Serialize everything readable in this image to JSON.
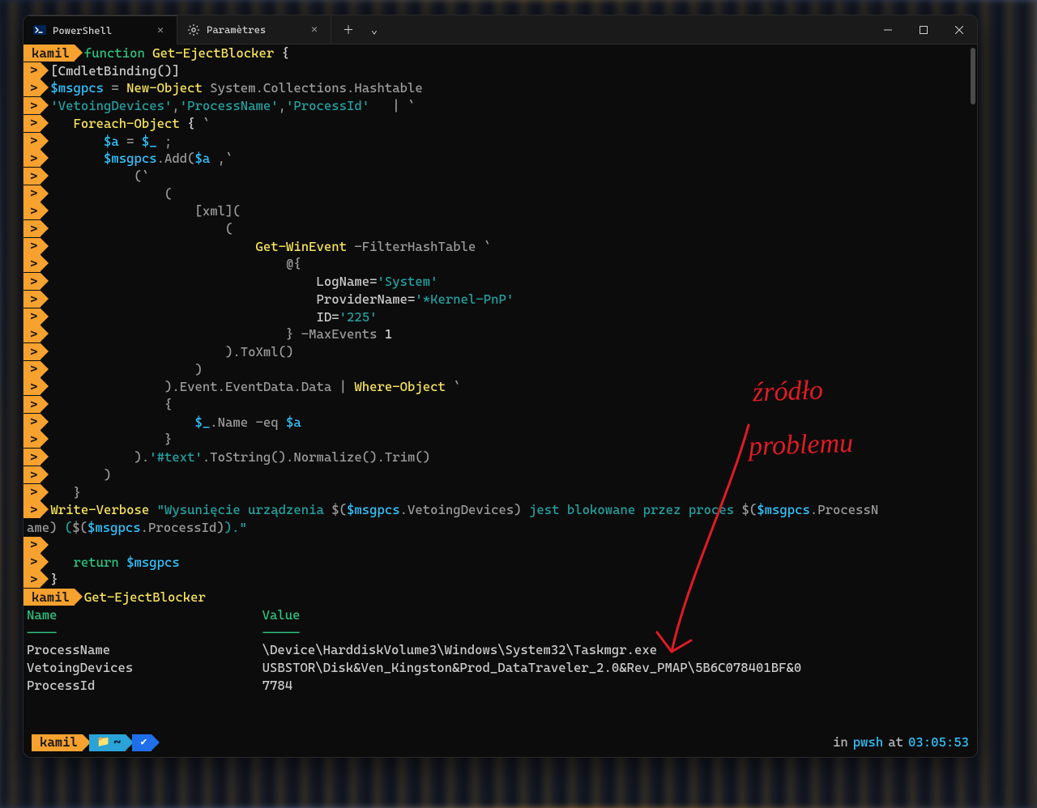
{
  "tabs": [
    {
      "label": "PowerShell",
      "active": true
    },
    {
      "label": "Paramètres",
      "active": false
    }
  ],
  "prompt_user": "kamil",
  "code_lines": [
    [
      [
        "kw",
        "function"
      ],
      [
        "sp",
        " "
      ],
      [
        "fn",
        "Get-EjectBlocker"
      ],
      [
        "sp",
        " "
      ],
      [
        "arrw",
        "{"
      ]
    ],
    [
      [
        "arrw",
        "[CmdletBinding()]"
      ]
    ],
    [
      [
        "var",
        "$msgpcs"
      ],
      [
        "sp",
        " "
      ],
      [
        "op",
        "="
      ],
      [
        "sp",
        " "
      ],
      [
        "cmd",
        "New-Object"
      ],
      [
        "sp",
        " "
      ],
      [
        "dim",
        "System.Collections.Hashtable"
      ]
    ],
    [
      [
        "str",
        "'VetoingDevices'"
      ],
      [
        "op",
        ","
      ],
      [
        "str",
        "'ProcessName'"
      ],
      [
        "op",
        ","
      ],
      [
        "str",
        "'ProcessId'"
      ],
      [
        "sp",
        "   "
      ],
      [
        "op",
        "|"
      ],
      [
        "sp",
        " "
      ],
      [
        "op",
        "`"
      ]
    ],
    [
      [
        "sp",
        "   "
      ],
      [
        "cmd",
        "Foreach-Object"
      ],
      [
        "sp",
        " "
      ],
      [
        "arrw",
        "{"
      ],
      [
        "sp",
        " "
      ],
      [
        "op",
        "`"
      ]
    ],
    [
      [
        "sp",
        "       "
      ],
      [
        "var",
        "$a"
      ],
      [
        "sp",
        " "
      ],
      [
        "op",
        "="
      ],
      [
        "sp",
        " "
      ],
      [
        "var",
        "$_"
      ],
      [
        "sp",
        " "
      ],
      [
        "op",
        ";"
      ]
    ],
    [
      [
        "sp",
        "       "
      ],
      [
        "var",
        "$msgpcs"
      ],
      [
        "op",
        ".Add("
      ],
      [
        "var",
        "$a"
      ],
      [
        "sp",
        " "
      ],
      [
        "op",
        ",`"
      ]
    ],
    [
      [
        "sp",
        "           "
      ],
      [
        "op",
        "(`"
      ]
    ],
    [
      [
        "sp",
        "               "
      ],
      [
        "op",
        "("
      ]
    ],
    [
      [
        "sp",
        "                   "
      ],
      [
        "op",
        "[xml]("
      ]
    ],
    [
      [
        "sp",
        "                       "
      ],
      [
        "op",
        "("
      ]
    ],
    [
      [
        "sp",
        "                           "
      ],
      [
        "cmd",
        "Get-WinEvent"
      ],
      [
        "sp",
        " "
      ],
      [
        "dim",
        "-FilterHashTable"
      ],
      [
        "sp",
        " "
      ],
      [
        "op",
        "`"
      ]
    ],
    [
      [
        "sp",
        "                               "
      ],
      [
        "op",
        "@{"
      ]
    ],
    [
      [
        "sp",
        "                                   "
      ],
      [
        "arrw",
        "LogName="
      ],
      [
        "str",
        "'System'"
      ]
    ],
    [
      [
        "sp",
        "                                   "
      ],
      [
        "arrw",
        "ProviderName="
      ],
      [
        "str",
        "'*Kernel-PnP'"
      ]
    ],
    [
      [
        "sp",
        "                                   "
      ],
      [
        "arrw",
        "ID="
      ],
      [
        "str",
        "'225'"
      ]
    ],
    [
      [
        "sp",
        "                               "
      ],
      [
        "op",
        "}"
      ],
      [
        "sp",
        " "
      ],
      [
        "dim",
        "-MaxEvents"
      ],
      [
        "sp",
        " "
      ],
      [
        "num",
        "1"
      ]
    ],
    [
      [
        "sp",
        "                       "
      ],
      [
        "op",
        ").ToXml()"
      ]
    ],
    [
      [
        "sp",
        "                   "
      ],
      [
        "op",
        ")"
      ]
    ],
    [
      [
        "sp",
        "               "
      ],
      [
        "op",
        ").Event.EventData.Data"
      ],
      [
        "sp",
        " "
      ],
      [
        "op",
        "|"
      ],
      [
        "sp",
        " "
      ],
      [
        "cmd",
        "Where-Object"
      ],
      [
        "sp",
        " "
      ],
      [
        "op",
        "`"
      ]
    ],
    [
      [
        "sp",
        "               "
      ],
      [
        "op",
        "{"
      ]
    ],
    [
      [
        "sp",
        "                   "
      ],
      [
        "var",
        "$_"
      ],
      [
        "op",
        ".Name"
      ],
      [
        "sp",
        " "
      ],
      [
        "dim",
        "-eq"
      ],
      [
        "sp",
        " "
      ],
      [
        "var",
        "$a"
      ]
    ],
    [
      [
        "sp",
        "               "
      ],
      [
        "op",
        "}"
      ]
    ],
    [
      [
        "sp",
        "           "
      ],
      [
        "op",
        ")."
      ],
      [
        "str",
        "'#text'"
      ],
      [
        "op",
        ".ToString().Normalize().Trim()"
      ]
    ],
    [
      [
        "sp",
        "       "
      ],
      [
        "op",
        ")"
      ]
    ],
    [
      [
        "sp",
        "   "
      ],
      [
        "op",
        "}"
      ]
    ]
  ],
  "wrap_line_1_a": "Write-Verbose",
  "wrap_line_1_b": "\"Wysunięcie urządzenia ",
  "wrap_line_1_c": "$(",
  "wrap_line_1_d": "$msgpcs",
  "wrap_line_1_e": ".VetoingDevices",
  "wrap_line_1_f": ")",
  "wrap_line_1_g": " jest blokowane przez proces ",
  "wrap_line_1_h": "$(",
  "wrap_line_1_i": "$msgpcs",
  "wrap_line_1_j": ".ProcessN",
  "wrap_line_2_a": "ame",
  "wrap_line_2_b": ") ",
  "wrap_line_2_c": "(",
  "wrap_line_2_d": "$(",
  "wrap_line_2_e": "$msgpcs",
  "wrap_line_2_f": ".ProcessId",
  "wrap_line_2_g": ")",
  "wrap_line_2_h": ").\"",
  "blank_rows": 1,
  "return_line_a": "return",
  "return_line_b": "$msgpcs",
  "close_brace": "}",
  "second_prompt_cmd": "Get-EjectBlocker",
  "table": {
    "headers": [
      "Name",
      "Value"
    ],
    "rules": [
      "----",
      "-----"
    ],
    "rows": [
      [
        "ProcessName",
        "\\Device\\HarddiskVolume3\\Windows\\System32\\Taskmgr.exe"
      ],
      [
        "VetoingDevices",
        "USBSTOR\\Disk&Ven_Kingston&Prod_DataTraveler_2.0&Rev_PMAP\\5B6C078401BF&0"
      ],
      [
        "ProcessId",
        "7784"
      ]
    ]
  },
  "status": {
    "user": "kamil",
    "folder": "~",
    "in": "in",
    "shell": "pwsh",
    "at": "at",
    "time": "03:05:53"
  },
  "annotation": {
    "line1": "źródło",
    "line2": "problemu"
  }
}
